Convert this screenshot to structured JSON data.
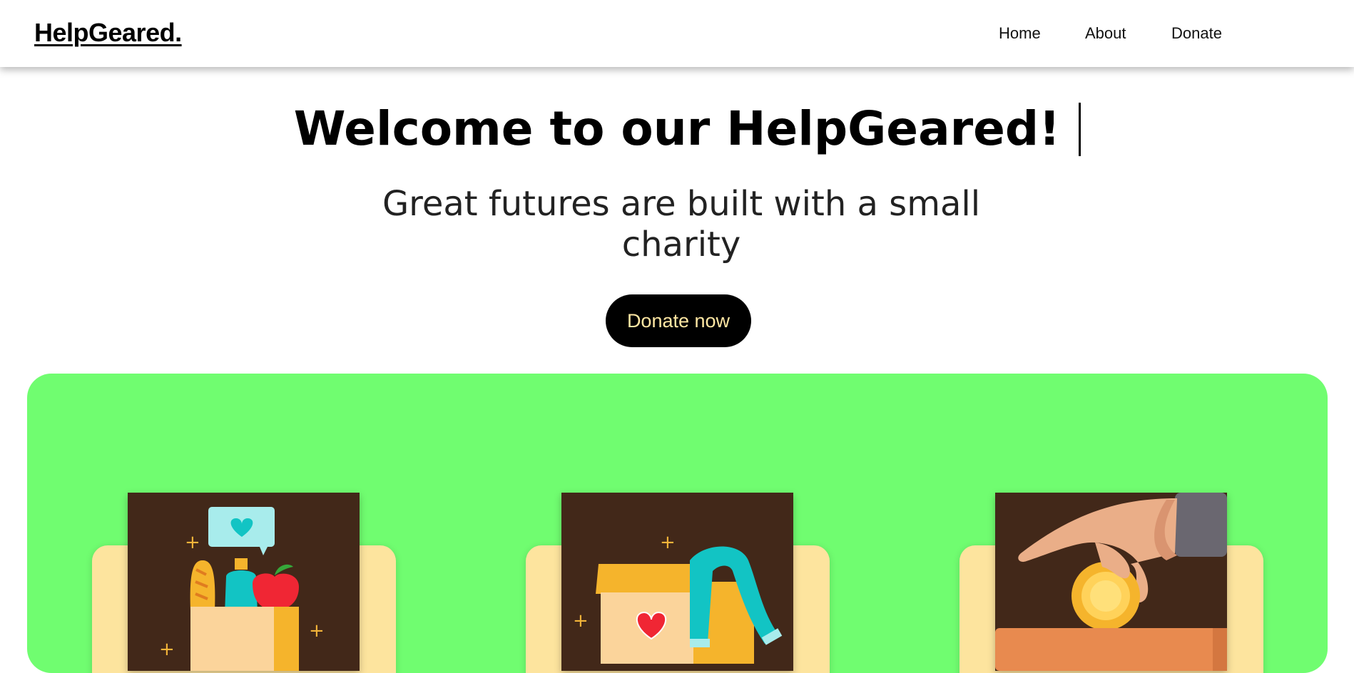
{
  "navbar": {
    "logo": "HelpGeared.",
    "links": [
      "Home",
      "About",
      "Donate"
    ]
  },
  "hero": {
    "title": "Welcome to our HelpGeared!",
    "subtitle": "Great futures are built with a small charity",
    "cta_label": "Donate now"
  },
  "cards": [
    {
      "icon": "grocery-bag-icon"
    },
    {
      "icon": "donation-box-icon"
    },
    {
      "icon": "coin-donation-icon"
    }
  ],
  "colors": {
    "panel": "#70fd70",
    "card_back": "#fde49e",
    "card_image_bg": "#422819",
    "button_bg": "#000000",
    "button_text": "#ffe7a3"
  }
}
